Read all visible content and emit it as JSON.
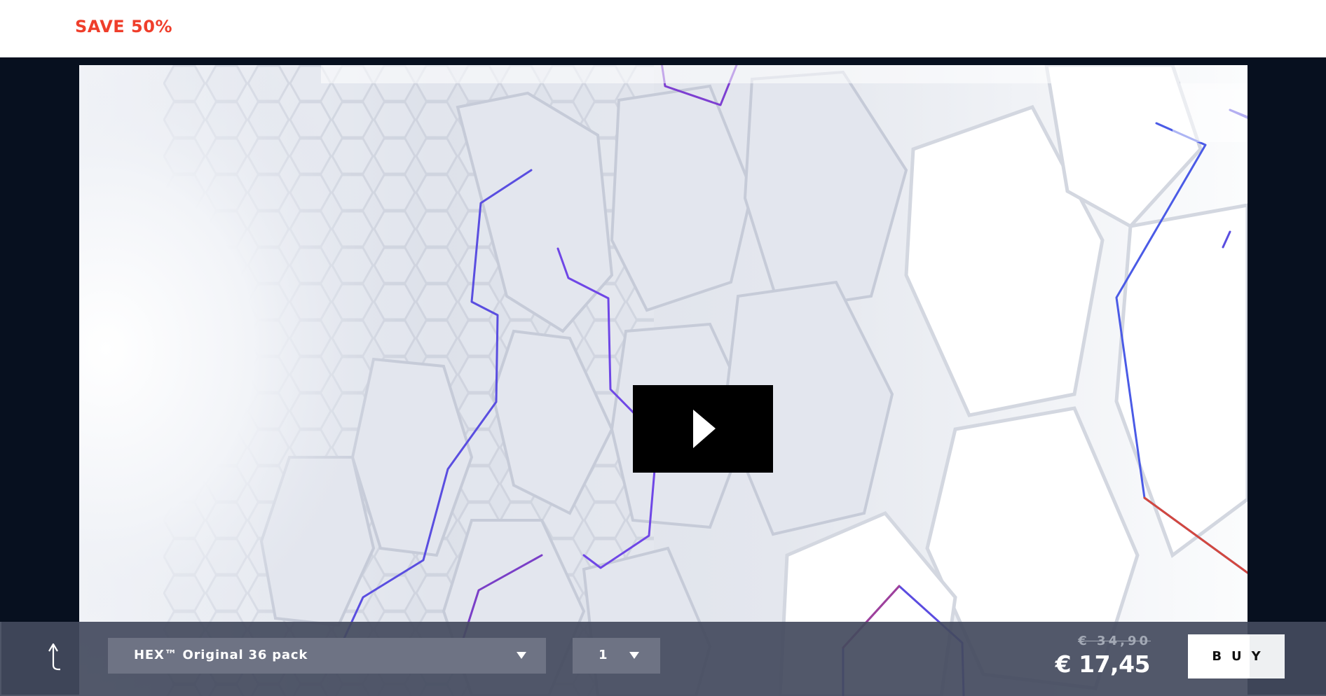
{
  "banner": {
    "save_label": "SAVE 50%"
  },
  "video": {
    "play_icon": "play-icon"
  },
  "buybar": {
    "back_icon": "back-arrow-icon",
    "variant": {
      "selected": "HEX™ Original 36 pack",
      "icon": "chevron-down-icon"
    },
    "quantity": {
      "selected": "1",
      "icon": "chevron-down-icon"
    },
    "old_price": "€ 34,90",
    "new_price": "€ 17,45",
    "buy_label": "BUY"
  },
  "colors": {
    "accent_red": "#ef3e2b",
    "bar_bg": "#434a5d",
    "select_bg": "#6e7384",
    "frame_bg": "#07101f"
  }
}
